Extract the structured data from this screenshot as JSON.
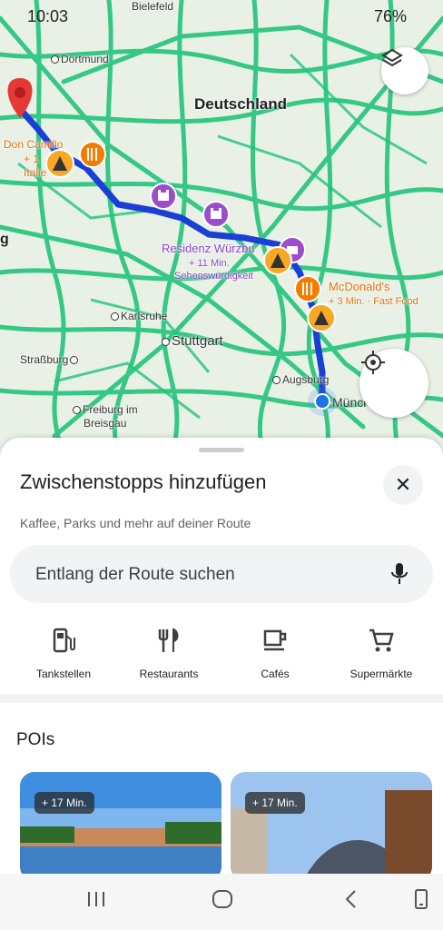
{
  "status_bar": {
    "time": "10:03",
    "battery": "76%"
  },
  "map": {
    "labels": {
      "dortmund": "Dortmund",
      "bielefeld": "Bielefeld",
      "deutschland": "Deutschland",
      "don_camillo": "Don Camillo",
      "don_camillo_time": "+ 1",
      "don_camillo_type": "Italie",
      "residenz": "Residenz Würzbu",
      "residenz_time": "+ 11 Min.",
      "residenz_type": "Sehenswürdigkeit",
      "mcdonalds": "McDonald's",
      "mcdonalds_time": "+ 3 Min. · Fast Food",
      "karlsruhe": "Karlsruhe",
      "stuttgart": "Stuttgart",
      "strassburg": "Straßburg",
      "augsburg": "Augsburg",
      "muenchen": "Münch",
      "freiburg": "Freiburg im",
      "breisgau": "Breisgau",
      "left_g": "g"
    }
  },
  "sheet": {
    "title": "Zwischenstopps hinzufügen",
    "subtitle": "Kaffee, Parks und mehr auf deiner Route",
    "search_placeholder": "Entlang der Route suchen",
    "categories": [
      {
        "label": "Tankstellen",
        "icon": "gas-station-icon"
      },
      {
        "label": "Restaurants",
        "icon": "restaurant-icon"
      },
      {
        "label": "Cafés",
        "icon": "cafe-icon"
      },
      {
        "label": "Supermärkte",
        "icon": "shopping-cart-icon"
      }
    ],
    "pois_title": "POIs",
    "cards": [
      {
        "badge": "+ 17 Min."
      },
      {
        "badge": "+ 17 Min."
      }
    ]
  },
  "colors": {
    "route": "#1a3fd6",
    "roads": "#1fc97a",
    "accent_orange": "#e8710a",
    "accent_purple": "#8e44c9"
  }
}
